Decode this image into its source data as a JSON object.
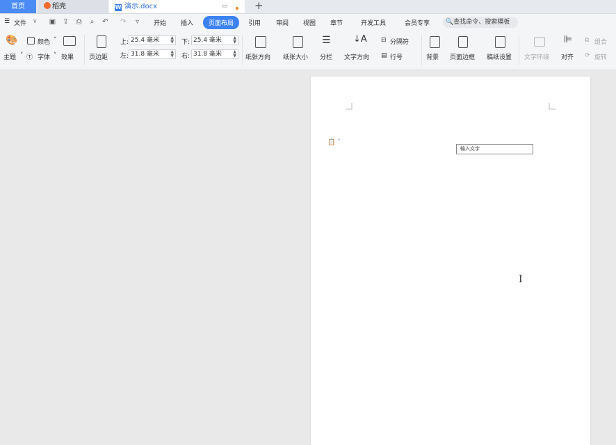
{
  "tabs": {
    "home": "首页",
    "daoke": "稻壳",
    "doc": "演示.docx",
    "new_tab": "+"
  },
  "menu": {
    "file": "文件",
    "items": [
      "开始",
      "插入",
      "页面布局",
      "引用",
      "审阅",
      "视图",
      "章节",
      "开发工具",
      "会员专享"
    ],
    "active": "页面布局",
    "search_placeholder": "查找命令、搜索模板"
  },
  "ribbon": {
    "theme": "主题",
    "colors": "颜色",
    "fonts": "字体",
    "effects": "效果",
    "margins": "页边距",
    "margin_top_label": "上:",
    "margin_top": "25.4 毫米",
    "margin_bottom_label": "下:",
    "margin_bottom": "25.4 毫米",
    "margin_left_label": "左:",
    "margin_left": "31.8 毫米",
    "margin_right_label": "右:",
    "margin_right": "31.8 毫米",
    "orientation": "纸张方向",
    "size": "纸张大小",
    "columns": "分栏",
    "text_direction": "文字方向",
    "breaks": "分隔符",
    "line_numbers": "行号",
    "background": "背景",
    "page_border": "页面边框",
    "manuscript": "稿纸设置",
    "text_wrap": "文字环绕",
    "align": "对齐",
    "group": "组合",
    "rotate": "旋转"
  },
  "document": {
    "textbox_text": "输入文字"
  },
  "colors": {
    "accent": "#3d82f5",
    "home_tab": "#4a8bf5",
    "daoke_logo": "#f06a2b"
  }
}
